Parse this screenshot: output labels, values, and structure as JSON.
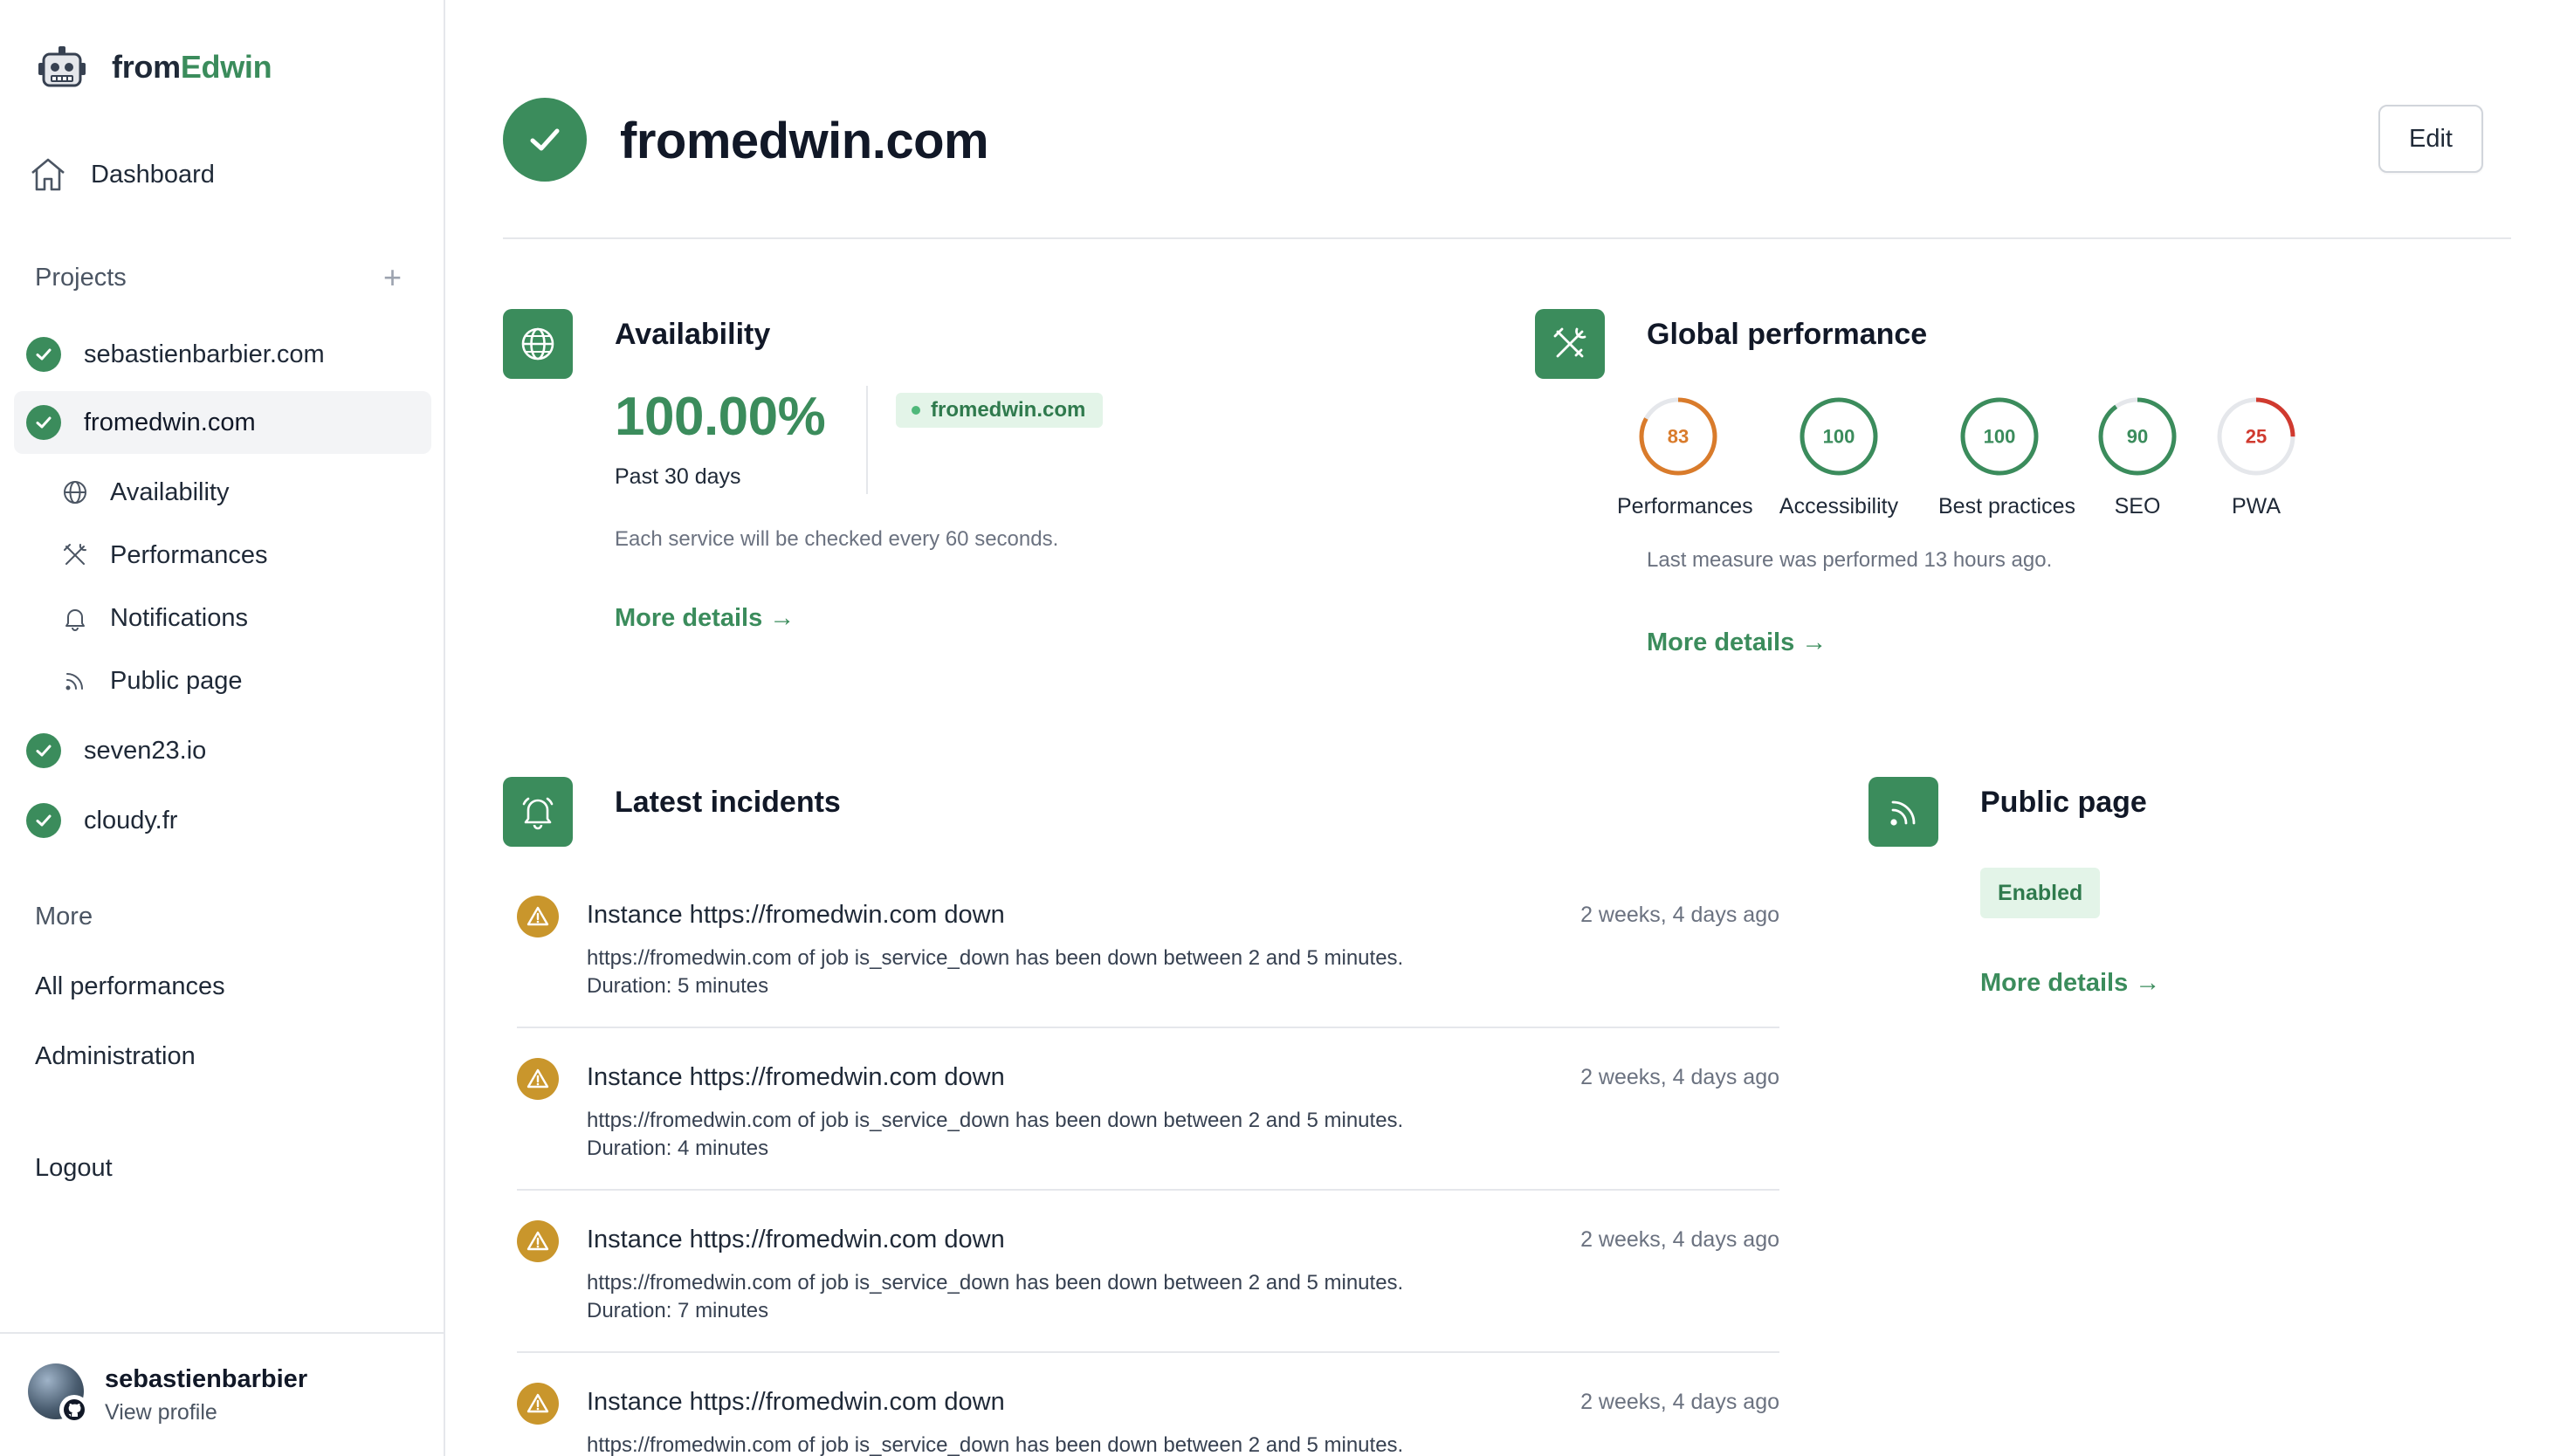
{
  "brand": {
    "name_prefix": "from",
    "name_accent": "Edwin",
    "accent_color": "#3b8c5c"
  },
  "sidebar": {
    "dashboard_label": "Dashboard",
    "projects_label": "Projects",
    "add_label": "+",
    "projects": [
      {
        "label": "sebastienbarbier.com",
        "status": "up",
        "active": false
      },
      {
        "label": "fromedwin.com",
        "status": "up",
        "active": true
      },
      {
        "label": "seven23.io",
        "status": "up",
        "active": false
      },
      {
        "label": "cloudy.fr",
        "status": "up",
        "active": false
      }
    ],
    "subnav": [
      {
        "label": "Availability",
        "icon": "globe-icon"
      },
      {
        "label": "Performances",
        "icon": "tools-icon"
      },
      {
        "label": "Notifications",
        "icon": "bell-icon"
      },
      {
        "label": "Public page",
        "icon": "rss-icon"
      }
    ],
    "more_label": "More",
    "links": {
      "all_performances": "All performances",
      "administration": "Administration",
      "logout": "Logout"
    },
    "profile": {
      "name": "sebastienbarbier",
      "view": "View profile"
    }
  },
  "header": {
    "title": "fromedwin.com",
    "edit_label": "Edit"
  },
  "availability": {
    "title": "Availability",
    "percentage": "100.00%",
    "period": "Past 30 days",
    "service": "fromedwin.com",
    "note": "Each service will be checked every 60 seconds.",
    "more": "More details →"
  },
  "performance": {
    "title": "Global performance",
    "scores": [
      {
        "label": "Performances",
        "value": 83,
        "color": "#d97b2b"
      },
      {
        "label": "Accessibility",
        "value": 100,
        "color": "#3b8c5c"
      },
      {
        "label": "Best practices",
        "value": 100,
        "color": "#3b8c5c"
      },
      {
        "label": "SEO",
        "value": 90,
        "color": "#3b8c5c"
      },
      {
        "label": "PWA",
        "value": 25,
        "color": "#d03a2f"
      }
    ],
    "note": "Last measure was performed 13 hours ago.",
    "more": "More details →"
  },
  "incidents": {
    "title": "Latest incidents",
    "items": [
      {
        "title": "Instance https://fromedwin.com down",
        "time": "2 weeks, 4 days ago",
        "desc": "https://fromedwin.com of job is_service_down has been down between 2 and 5 minutes.",
        "duration": "Duration: 5 minutes"
      },
      {
        "title": "Instance https://fromedwin.com down",
        "time": "2 weeks, 4 days ago",
        "desc": "https://fromedwin.com of job is_service_down has been down between 2 and 5 minutes.",
        "duration": "Duration: 4 minutes"
      },
      {
        "title": "Instance https://fromedwin.com down",
        "time": "2 weeks, 4 days ago",
        "desc": "https://fromedwin.com of job is_service_down has been down between 2 and 5 minutes.",
        "duration": "Duration: 7 minutes"
      },
      {
        "title": "Instance https://fromedwin.com down",
        "time": "2 weeks, 4 days ago",
        "desc": "https://fromedwin.com of job is_service_down has been down between 2 and 5 minutes.",
        "duration": ""
      }
    ]
  },
  "public_page": {
    "title": "Public page",
    "status": "Enabled",
    "more": "More details →"
  }
}
